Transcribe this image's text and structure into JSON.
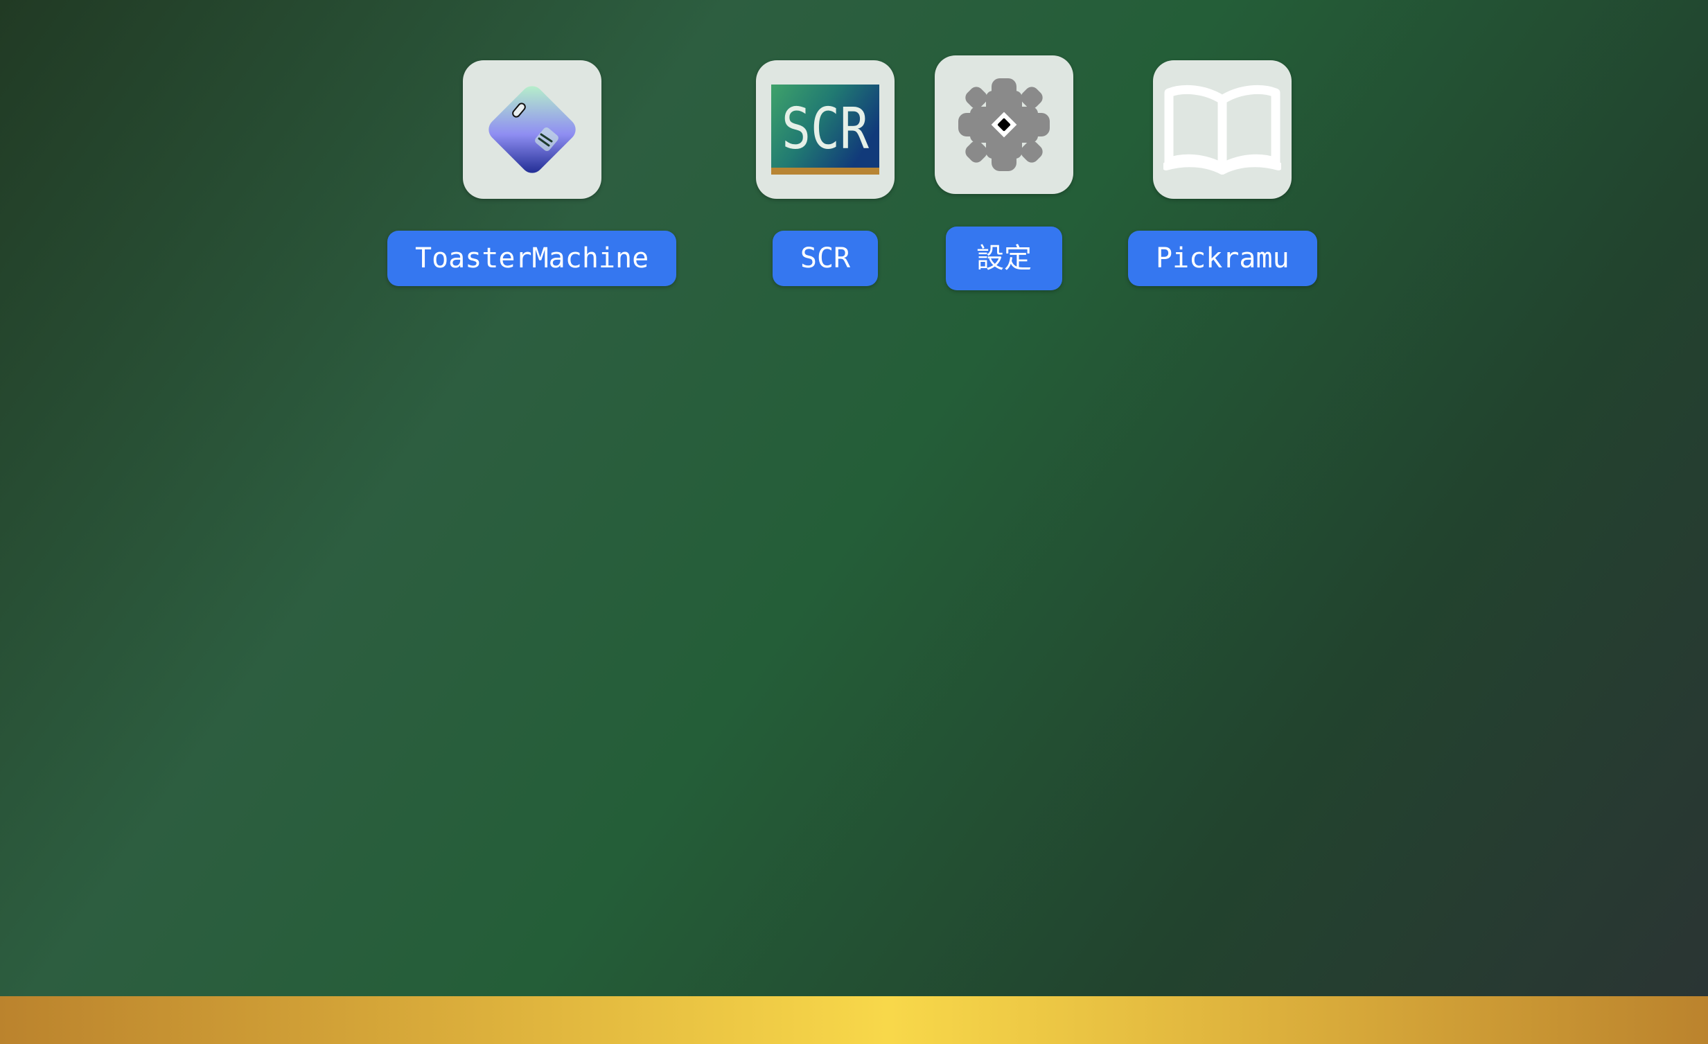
{
  "desktop": {
    "apps": [
      {
        "id": "toaster",
        "label": "ToasterMachine",
        "icon": "toaster-machine-icon"
      },
      {
        "id": "scr",
        "label": "SCR",
        "icon": "scr-icon",
        "icon_text": "SCR"
      },
      {
        "id": "settings",
        "label": "設定",
        "icon": "gear-icon"
      },
      {
        "id": "pickramu",
        "label": "Pickramu",
        "icon": "open-book-icon"
      }
    ]
  },
  "colors": {
    "label_background": "#3577f0",
    "tile_background": "#dfe6e1",
    "taskbar_center": "#f8d84a",
    "taskbar_edge": "#bb832d"
  }
}
